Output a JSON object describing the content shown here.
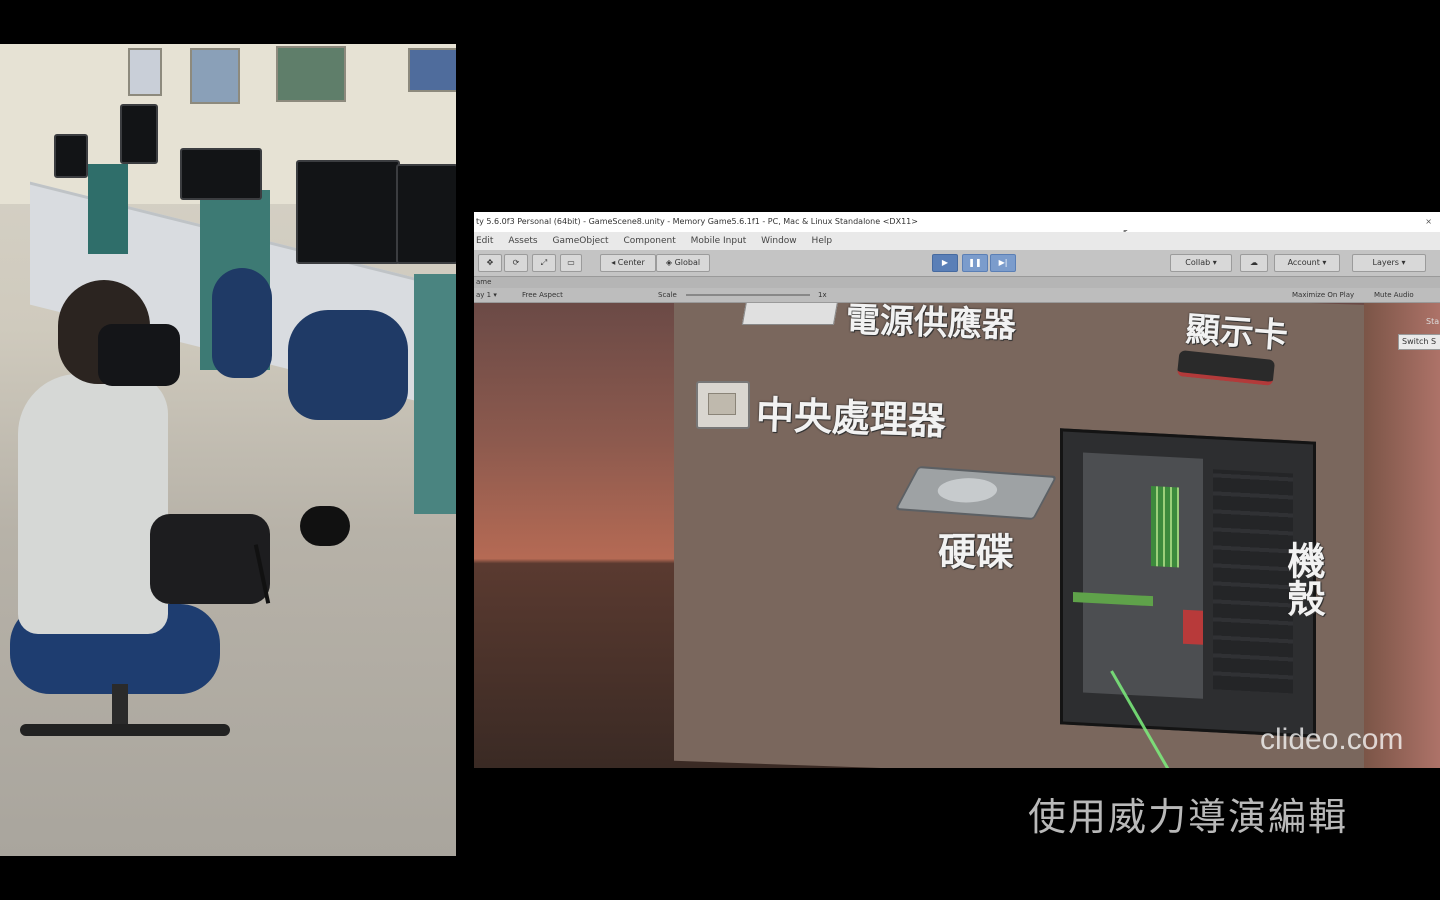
{
  "editor": {
    "window_title": "ty 5.6.0f3 Personal (64bit) - GameScene8.unity - Memory Game5.6.1f1 - PC, Mac & Linux Standalone <DX11>",
    "close_glyph": "×",
    "menu": [
      "Edit",
      "Assets",
      "GameObject",
      "Component",
      "Mobile Input",
      "Window",
      "Help"
    ],
    "toolbar": {
      "center": "◂ Center",
      "global": "◈ Global",
      "collab": "Collab ▾",
      "account": "Account ▾",
      "layers": "Layers ▾",
      "play": "▶",
      "pause": "❚❚",
      "step": "▶|"
    },
    "tab": "ame",
    "gamebar": {
      "display": "ay 1 ▾",
      "aspect": "Free Aspect",
      "scale_label": "Scale",
      "scale_value": "1x",
      "maximize": "Maximize On Play",
      "mute": "Mute Audio"
    },
    "switch_label": "Switch S",
    "corner_text": "Sta"
  },
  "vr_scene": {
    "labels": {
      "psu": "電源供應器",
      "gpu": "顯示卡",
      "cpu": "中央處理器",
      "hdd": "硬碟",
      "case": "機殼"
    },
    "watermark": "clideo.com"
  },
  "subtitle": "使用威力導演編輯"
}
